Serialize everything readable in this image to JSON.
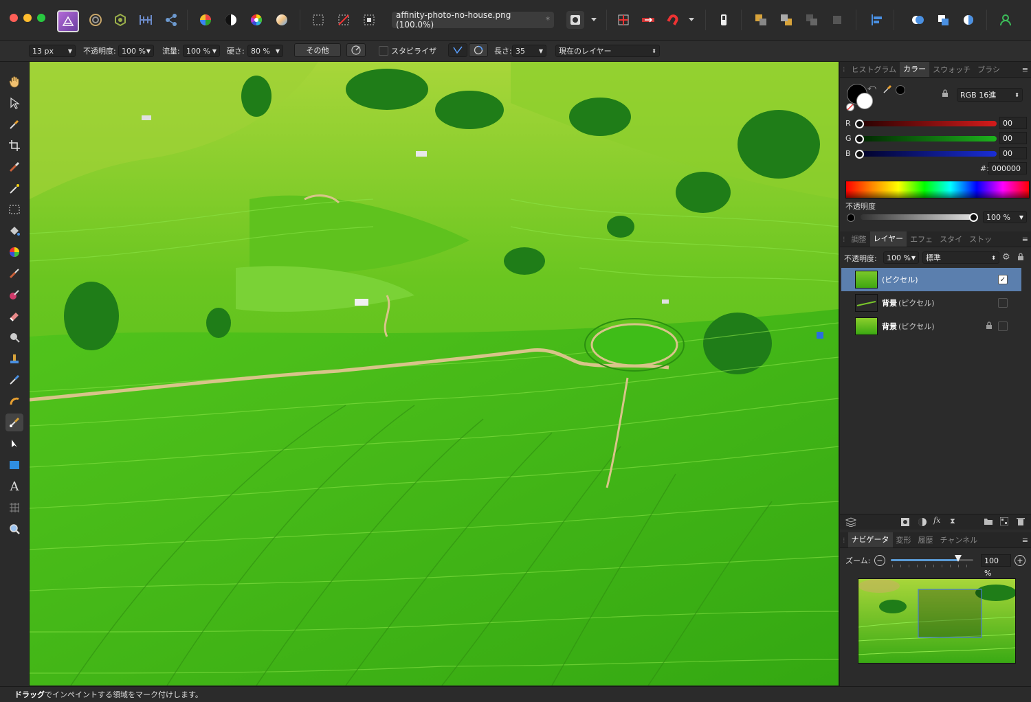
{
  "titlebar": {
    "document_tab": "affinity-photo-no-house.png (100.0%)",
    "document_tab_modified": "*"
  },
  "context_toolbar": {
    "width_value": "13 px",
    "opacity_label": "不透明度:",
    "opacity_value": "100 %",
    "flow_label": "流量:",
    "flow_value": "100 %",
    "hardness_label": "硬さ:",
    "hardness_value": "80 %",
    "more_button": "その他",
    "stabilizer_label": "スタビライザ",
    "length_label": "長さ:",
    "length_value": "35",
    "source_value": "現在のレイヤー"
  },
  "color_panel": {
    "tabs": [
      "ヒストグラム",
      "カラー",
      "スウォッチ",
      "ブラシ"
    ],
    "active_tab": "カラー",
    "mode": "RGB 16進",
    "r_label": "R",
    "r_value": "00",
    "g_label": "G",
    "g_value": "00",
    "b_label": "B",
    "b_value": "00",
    "hex_label": "#:",
    "hex_value": "000000",
    "opacity_label": "不透明度",
    "opacity_value": "100 %",
    "primary_color": "#000000",
    "secondary_color": "#ffffff"
  },
  "layers_panel": {
    "tabs": [
      "調整",
      "レイヤー",
      "エフェ",
      "スタイ",
      "ストッ"
    ],
    "active_tab": "レイヤー",
    "opacity_label": "不透明度:",
    "opacity_value": "100 %",
    "blend_mode": "標準",
    "layers": [
      {
        "name": "",
        "type": "(ピクセル)",
        "selected": true,
        "visible": true,
        "locked": false
      },
      {
        "name": "背景",
        "type": "(ピクセル)",
        "selected": false,
        "visible": false,
        "locked": false
      },
      {
        "name": "背景",
        "type": "(ピクセル)",
        "selected": false,
        "visible": false,
        "locked": true
      }
    ]
  },
  "navigator_panel": {
    "tabs": [
      "ナビゲータ",
      "変形",
      "履歴",
      "チャンネル"
    ],
    "active_tab": "ナビゲータ",
    "zoom_label": "ズーム:",
    "zoom_value": "100 %",
    "zoom_level": 0.82
  },
  "status_bar": {
    "bold_text": "ドラッグ",
    "text": "でインペイントする領域をマーク付けします。"
  },
  "colors": {
    "accent_selected": "#5b7fae",
    "canvas_field": "#46c21a",
    "red_slider": "#d41b1b",
    "green_slider": "#1db31d",
    "blue_slider": "#1a2ed6"
  }
}
